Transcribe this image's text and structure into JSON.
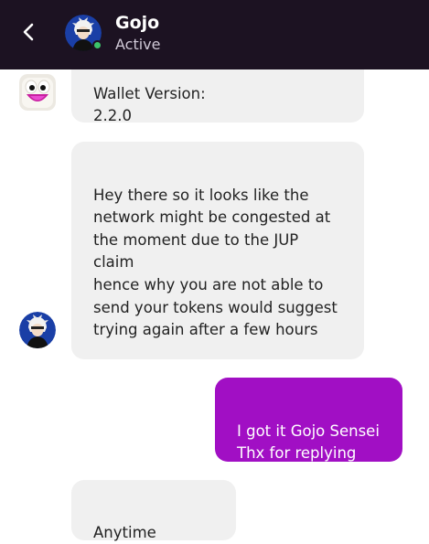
{
  "header": {
    "contact_name": "Gojo",
    "status": "Active",
    "back_icon": "chevron-left-icon"
  },
  "colors": {
    "header_bg": "#1c1222",
    "incoming_bubble": "#f0f0f0",
    "outgoing_bubble": "#a10fc4",
    "online_dot": "#3cc46a"
  },
  "messages": [
    {
      "direction": "incoming",
      "text": "Wallet Version:\n2.2.0"
    },
    {
      "direction": "incoming",
      "text": "Hey there so it looks like the\nnetwork might be congested at\nthe moment due to the JUP claim\nhence why you are not able to\nsend your tokens would suggest\ntrying again after a few hours"
    },
    {
      "direction": "outgoing",
      "text": "I got it Gojo Sensei\nThx for replying"
    },
    {
      "direction": "incoming",
      "text": "Anytime brother"
    }
  ]
}
